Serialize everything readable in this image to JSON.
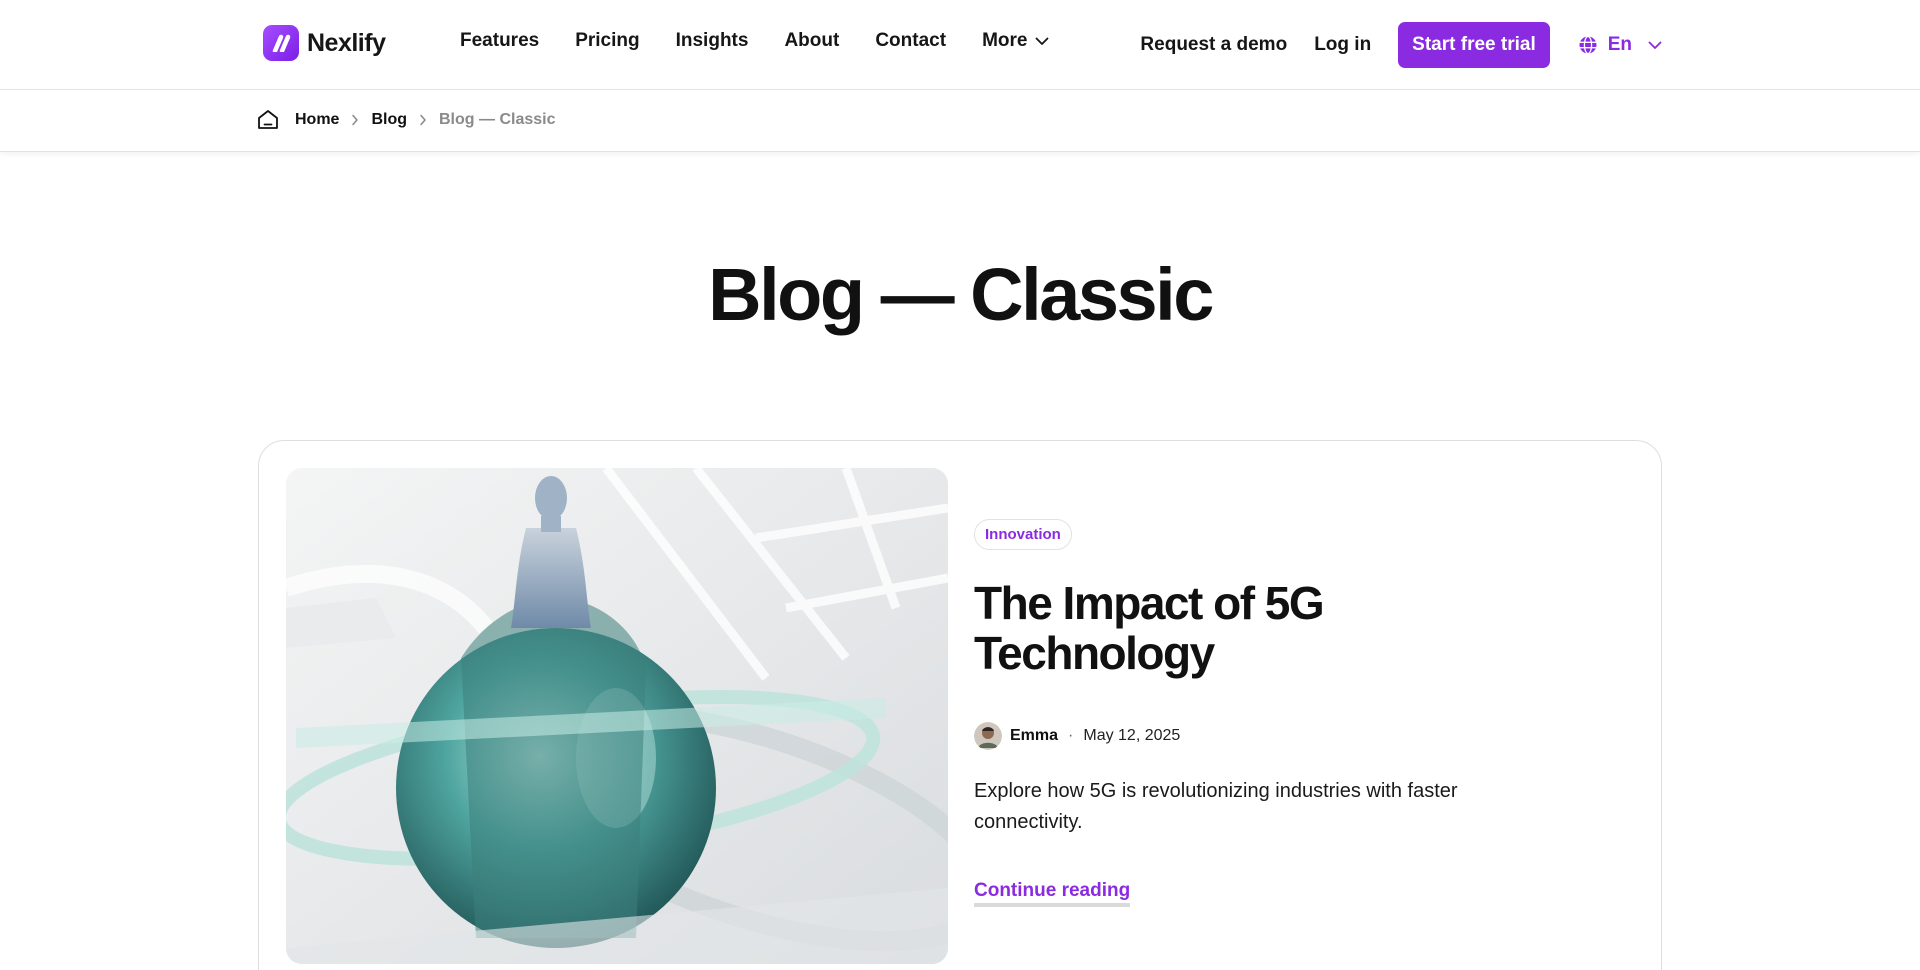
{
  "brand": {
    "name": "Nexlify",
    "accent": "#8a2be2"
  },
  "nav": {
    "items": [
      "Features",
      "Pricing",
      "Insights",
      "About",
      "Contact"
    ],
    "more_label": "More"
  },
  "header": {
    "demo_label": "Request a demo",
    "login_label": "Log in",
    "cta_label": "Start free trial",
    "language": "En"
  },
  "breadcrumb": {
    "items": [
      "Home",
      "Blog",
      "Blog — Classic"
    ]
  },
  "page": {
    "title": "Blog — Classic"
  },
  "post": {
    "category": "Innovation",
    "title": "The Impact of 5G Technology",
    "author": "Emma",
    "date": "May 12, 2025",
    "excerpt": "Explore how 5G is revolutionizing industries with faster connectivity.",
    "read_more": "Continue reading"
  }
}
